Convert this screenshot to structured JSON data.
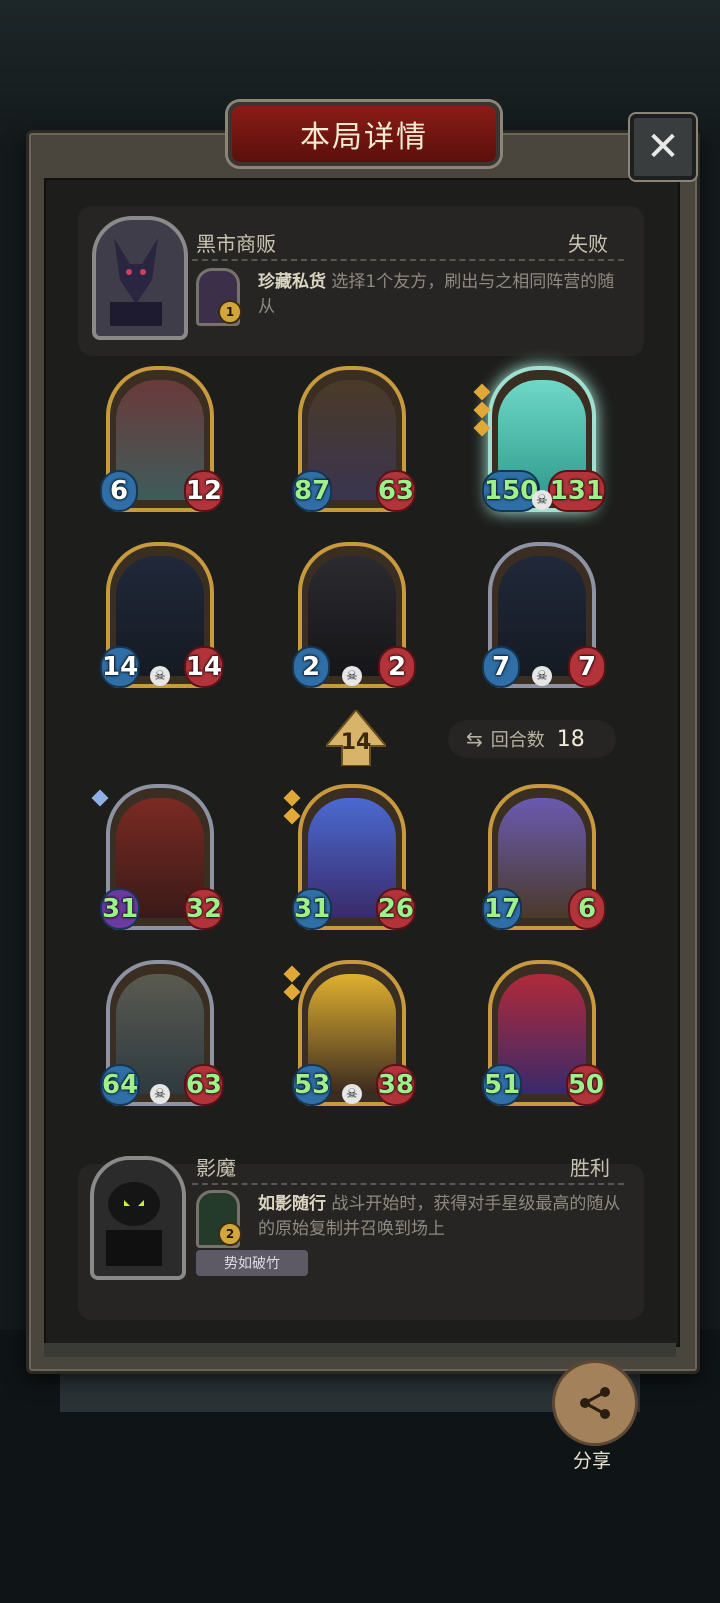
{
  "header": {
    "title": "本局详情",
    "close_icon": "close-icon"
  },
  "top_player": {
    "name": "黑市商贩",
    "result": "失败",
    "hero_power": {
      "name": "珍藏私货",
      "level": "1",
      "desc": "选择1个友方，刷出与之相同阵营的随从"
    }
  },
  "top_minions": [
    {
      "atk": "6",
      "hp": "12",
      "frame": "gold",
      "buffed": false
    },
    {
      "atk": "87",
      "hp": "63",
      "frame": "gold",
      "buffed": true
    },
    {
      "atk": "150",
      "hp": "131",
      "frame": "glow",
      "buffed": true
    },
    {
      "atk": "14",
      "hp": "14",
      "frame": "gold",
      "buffed": false
    },
    {
      "atk": "2",
      "hp": "2",
      "frame": "gold",
      "buffed": false
    },
    {
      "atk": "7",
      "hp": "7",
      "frame": "silver",
      "buffed": false
    }
  ],
  "tier": "14",
  "rounds": {
    "label": "回合数",
    "value": "18"
  },
  "bottom_minions": [
    {
      "atk": "31",
      "hp": "32",
      "frame": "silver",
      "buffed": true
    },
    {
      "atk": "31",
      "hp": "26",
      "frame": "gold",
      "buffed": true
    },
    {
      "atk": "17",
      "hp": "6",
      "frame": "gold",
      "buffed": true
    },
    {
      "atk": "64",
      "hp": "63",
      "frame": "silver",
      "buffed": true
    },
    {
      "atk": "53",
      "hp": "38",
      "frame": "gold",
      "buffed": true
    },
    {
      "atk": "51",
      "hp": "50",
      "frame": "gold",
      "buffed": true
    }
  ],
  "bottom_player": {
    "name": "影魔",
    "result": "胜利",
    "hero_power": {
      "name": "如影随行",
      "level": "2",
      "desc": "战斗开始时，获得对手星级最高的随从的原始复制并召唤到场上"
    },
    "tag": "势如破竹"
  },
  "share": {
    "label": "分享"
  },
  "colors": {
    "accent_red": "#8a1d16",
    "atk_blue": "#2f6ea6",
    "hp_red": "#b2343a",
    "buff_green": "#9ef08a"
  }
}
